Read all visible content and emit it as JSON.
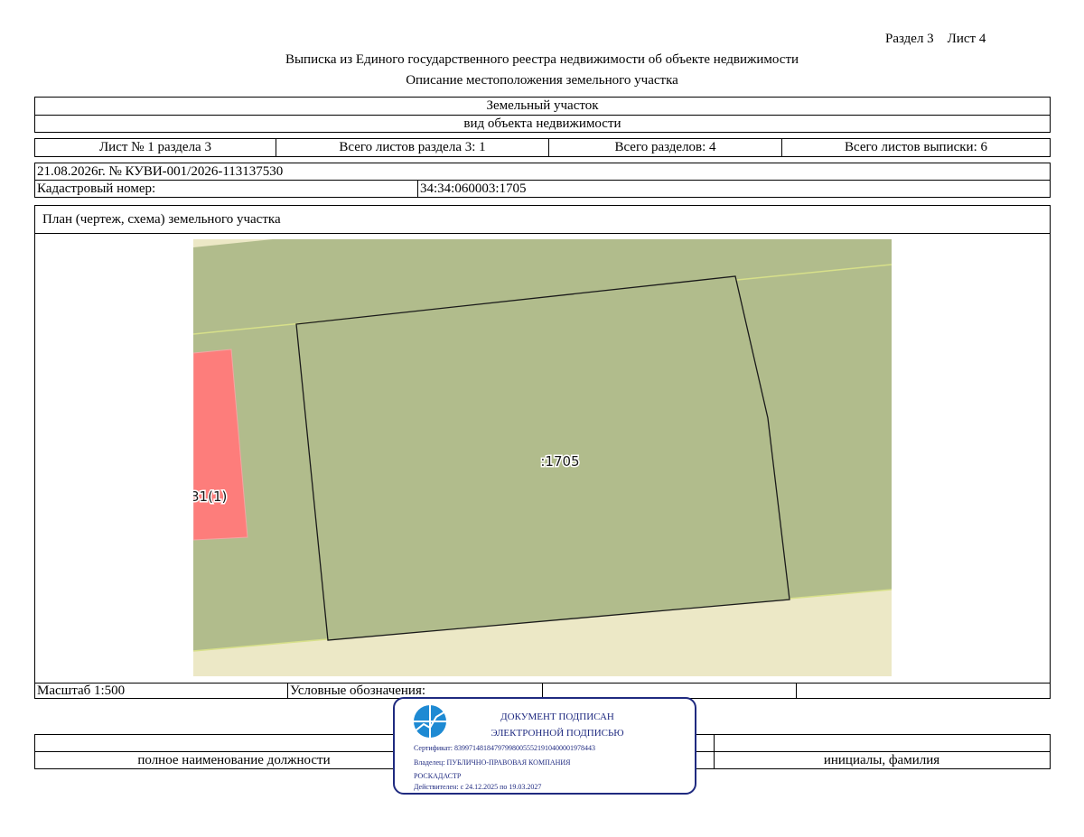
{
  "header": {
    "section_sheet": "Раздел 3    Лист 4",
    "title": "Выписка из Единого государственного реестра недвижимости об объекте недвижимости",
    "subtitle": "Описание местоположения земельного участка"
  },
  "object": {
    "type_value": "Земельный участок",
    "type_caption": "вид объекта недвижимости"
  },
  "sheets": {
    "sheet_no": "Лист № 1 раздела 3",
    "total_section_sheets": "Всего листов раздела 3: 1",
    "total_sections": "Всего разделов: 4",
    "total_extract_sheets": "Всего листов выписки: 6"
  },
  "record": {
    "date_number": "21.08.2026г. № КУВИ-001/2026-113137530",
    "cadastral_label": "Кадастровый номер:",
    "cadastral_value": "34:34:060003:1705"
  },
  "plan": {
    "title": "План (чертеж, схема) земельного участка",
    "parcel_label": ":1705",
    "neighbor_label": "31(1)",
    "colors": {
      "road": "#ece8c6",
      "zone": "#b1bc8c",
      "neighbor": "#fd7d7b",
      "boundary": "#1a1a1a",
      "edge": "#d7e08a"
    }
  },
  "footer_table": {
    "scale": "Масштаб 1:500",
    "legend_label": "Условные обозначения:"
  },
  "signature": {
    "position_caption": "полное наименование должности",
    "name_caption": "инициалы, фамилия"
  },
  "stamp": {
    "line1": "ДОКУМЕНТ ПОДПИСАН",
    "line2": "ЭЛЕКТРОННОЙ ПОДПИСЬЮ",
    "certificate": "Сертификат: 839971481847979980055521910400001978443",
    "owner_line1": "Владелец: ПУБЛИЧНО-ПРАВОВАЯ КОМПАНИЯ",
    "owner_line2": "РОСКАДАСТР",
    "validity": "Действителен: с 24.12.2025 по 19.03.2027",
    "icon": "rosreestr-logo-icon",
    "border_color": "#1f2a80"
  }
}
